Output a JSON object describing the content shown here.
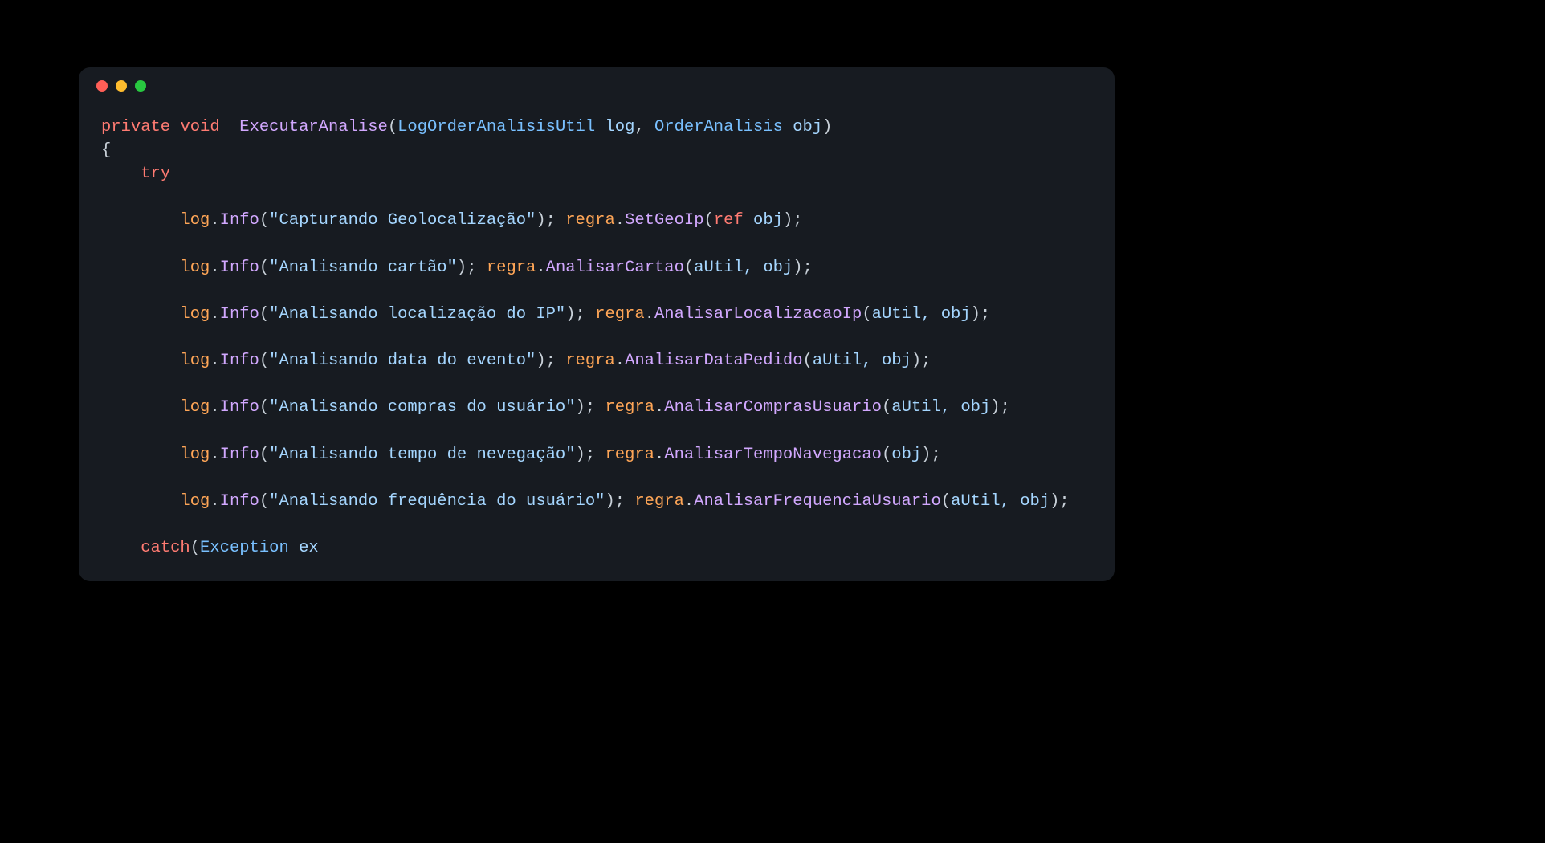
{
  "signature": {
    "kw_private": "private",
    "kw_void": "void",
    "fn_name": "_ExecutarAnalise",
    "param1_type": "LogOrderAnalisisUtil",
    "param1_name": "log",
    "param2_type": "OrderAnalisis",
    "param2_name": "obj"
  },
  "braces": {
    "open": "{",
    "close_paren_open": "(",
    "close_paren": ")"
  },
  "kw_try": "try",
  "kw_catch": "catch",
  "kw_ref": "ref",
  "exception_type": "Exception",
  "exception_var": "ex",
  "obj_log": "log",
  "obj_regra": "regra",
  "method_info": "Info",
  "lines": [
    {
      "msg": "\"Capturando Geolocalização\"",
      "call_fn": "SetGeoIp",
      "call_args_prefix_ref": true,
      "call_args": "obj"
    },
    {
      "msg": "\"Analisando cartão\"",
      "call_fn": "AnalisarCartao",
      "call_args_prefix_ref": false,
      "call_args": "aUtil, obj"
    },
    {
      "msg": "\"Analisando localização do IP\"",
      "call_fn": "AnalisarLocalizacaoIp",
      "call_args_prefix_ref": false,
      "call_args": "aUtil, obj"
    },
    {
      "msg": "\"Analisando data do evento\"",
      "call_fn": "AnalisarDataPedido",
      "call_args_prefix_ref": false,
      "call_args": "aUtil, obj"
    },
    {
      "msg": "\"Analisando compras do usuário\"",
      "call_fn": "AnalisarComprasUsuario",
      "call_args_prefix_ref": false,
      "call_args": "aUtil, obj"
    },
    {
      "msg": "\"Analisando tempo de nevegação\"",
      "call_fn": "AnalisarTempoNavegacao",
      "call_args_prefix_ref": false,
      "call_args": "obj"
    },
    {
      "msg": "\"Analisando frequência do usuário\"",
      "call_fn": "AnalisarFrequenciaUsuario",
      "call_args_prefix_ref": false,
      "call_args": "aUtil, obj"
    }
  ]
}
